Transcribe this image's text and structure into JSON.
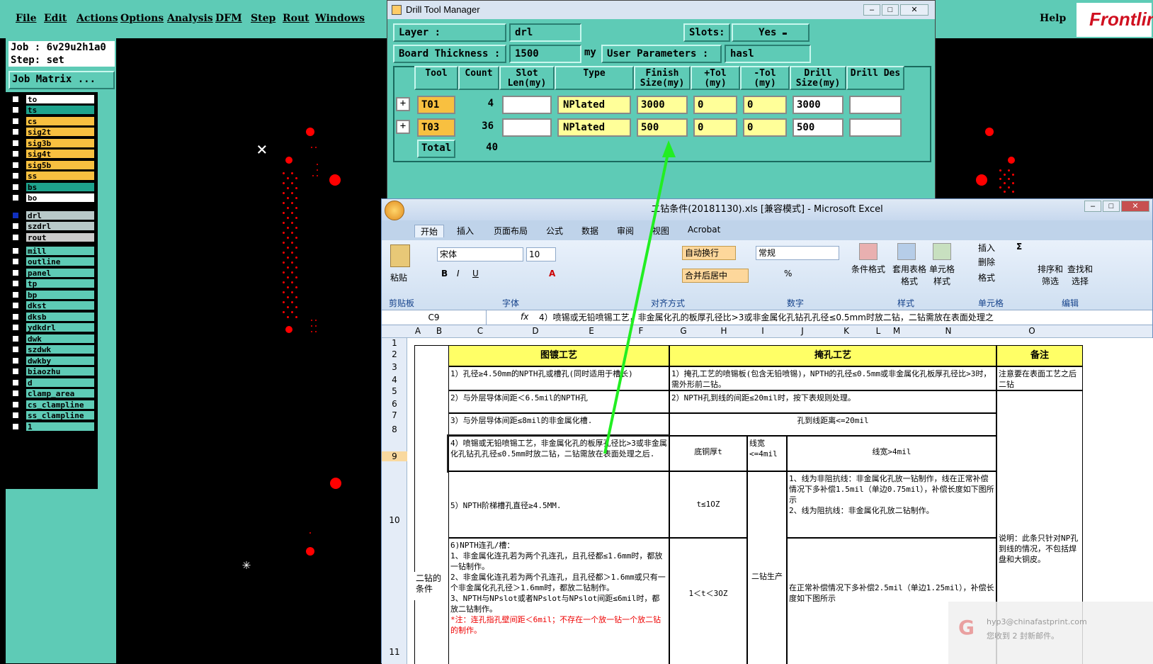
{
  "menubar": {
    "items": [
      "File",
      "Edit",
      "Actions",
      "Options",
      "Analysis",
      "DFM",
      "Step",
      "Rout",
      "Windows"
    ],
    "help": "Help",
    "logo": "Frontline"
  },
  "job": {
    "job_line": "Job : 6v29u2h1a0",
    "step_line": "Step: set",
    "matrix_button": "Job Matrix ..."
  },
  "layers": {
    "group1": [
      "to",
      "ts",
      "cs",
      "sig2t",
      "sig3b",
      "sig4t",
      "sig5b",
      "ss",
      "bs",
      "bo"
    ],
    "group2": [
      "drl",
      "szdrl",
      "rout"
    ],
    "group3": [
      "mill",
      "outline",
      "panel",
      "tp",
      "bp",
      "dkst",
      "dksb",
      "ydkdrl",
      "dwk",
      "szdwk",
      "dwkby",
      "biaozhu",
      "d",
      "clamp_area",
      "cs_clampline",
      "ss_clampline",
      "1"
    ]
  },
  "drill_tool_manager": {
    "title": "Drill Tool Manager",
    "layer_label": "Layer :",
    "layer_value": "drl",
    "slots_label": "Slots:",
    "slots_value": "Yes",
    "board_thickness_label": "Board Thickness :",
    "board_thickness_value": "1500",
    "board_thickness_unit": "my",
    "user_params_label": "User Parameters :",
    "user_params_value": "hasl",
    "columns": [
      "Tool",
      "Count",
      "Slot Len(my)",
      "Type",
      "Finish Size(my)",
      "+Tol (my)",
      "-Tol (my)",
      "Drill Size(my)",
      "Drill Des"
    ],
    "rows": [
      {
        "tool": "T01",
        "count": "4",
        "type": "NPlated",
        "finish": "3000",
        "ptol": "0",
        "mtol": "0",
        "drill": "3000"
      },
      {
        "tool": "T03",
        "count": "36",
        "type": "NPlated",
        "finish": "500",
        "ptol": "0",
        "mtol": "0",
        "drill": "500"
      }
    ],
    "total_label": "Total",
    "total_value": "40"
  },
  "excel": {
    "title": "二钻条件(20181130).xls [兼容模式] - Microsoft Excel",
    "tabs": [
      "开始",
      "插入",
      "页面布局",
      "公式",
      "数据",
      "审阅",
      "视图",
      "Acrobat"
    ],
    "ribbon": {
      "paste": "粘贴",
      "clipboard": "剪贴板",
      "font_name": "宋体",
      "font_size": "10",
      "font_group": "字体",
      "wrap": "自动换行",
      "merge": "合并后居中",
      "align_group": "对齐方式",
      "number_format": "常规",
      "number_group": "数字",
      "cond_format": "条件格式",
      "table_format": "套用表格格式",
      "cell_style": "单元格样式",
      "style_group": "样式",
      "insert": "插入",
      "delete": "删除",
      "format": "格式",
      "cells_group": "单元格",
      "sort_filter": "排序和筛选",
      "find_select": "查找和选择",
      "edit_group": "编辑"
    },
    "name_box": "C9",
    "formula": "4）喷锡或无铅喷锡工艺，非金属化孔的板厚孔径比>3或非金属化孔钻孔孔径≤0.5mm时放二钻，二钻需放在表面处理之",
    "columns": [
      "A",
      "B",
      "C",
      "D",
      "E",
      "F",
      "G",
      "H",
      "I",
      "J",
      "K",
      "L",
      "M",
      "N",
      "O"
    ],
    "rows": [
      "1",
      "2",
      "3",
      "4",
      "5",
      "6",
      "7",
      "8",
      "9",
      "10",
      "11"
    ],
    "sheet": {
      "h_plating": "图镀工艺",
      "h_plugging": "掩孔工艺",
      "h_note": "备注",
      "b_label": "二钻的条件",
      "c1": "1）孔径≥4.50mm的NPTH孔或槽孔(同时适用于槽长)",
      "c2": "2）与外层导体间距＜6.5mil的NPTH孔",
      "c3": "3）与外层导体间距≤8mil的非金属化槽.",
      "c4": "4）喷锡或无铅喷锡工艺，非金属化孔的板厚孔径比>3或非金属化孔钻孔孔径≤0.5mm时放二钻，二钻需放在表面处理之后.",
      "c5": "5）NPTH阶梯槽孔直径≥4.5MM.",
      "c6a": "6)NPTH连孔/槽：",
      "c6b": "1、非金属化连孔若为两个孔连孔，且孔径都≤1.6mm时，都放一钻制作。",
      "c6c": "2、非金属化连孔若为两个孔连孔，且孔径都＞1.6mm或只有一个非金属化孔孔径＞1.6mm时，都放二钻制作。",
      "c6d": "3、NPTH与NPslot或者NPslot与NPslot间距≤6mil时，都放二钻制作。",
      "c6note": "*注：连孔指孔壁间距＜6mil；不存在一个放一钻一个放二钻的制作。",
      "g1": "1）掩孔工艺的喷锡板(包含无铅喷锡)，NPTH的孔径≤0.5mm或非金属化孔板厚孔径比>3时，需外形前二钻。",
      "g2": "2）NPTH孔到线的间距≤20mil时，按下表规则处理。",
      "g3": "孔到线距离<=20mil",
      "g_copper": "底铜厚t",
      "g_lw1": "线宽<=4mil",
      "g_lw2": "线宽>4mil",
      "g_t1": "t≤1OZ",
      "g_t2": "1＜t＜3OZ",
      "g_prod": "二钻生产",
      "g_r1": "1、线为非阻抗线：非金属化孔放一钻制作，线在正常补偿情况下多补偿1.5mil（单边0.75mil），补偿长度如下图所示\n2、线为阻抗线：非金属化孔放二钻制作。",
      "g_r2": "在正常补偿情况下多补偿2.5mil（单边1.25mil），补偿长度如下图所示",
      "o1": "注意要在表面工艺之后二钻",
      "o2": "说明：此条只针对NP孔到线的情况，不包括焊盘和大铜皮。"
    }
  },
  "notification": {
    "email": "hyp3@chinafastprint.com",
    "message": "您收到 2 封新邮件。"
  },
  "colors": {
    "teal": "#5ecbb6",
    "drill": "#ff0000",
    "arrow": "#22ee22"
  }
}
